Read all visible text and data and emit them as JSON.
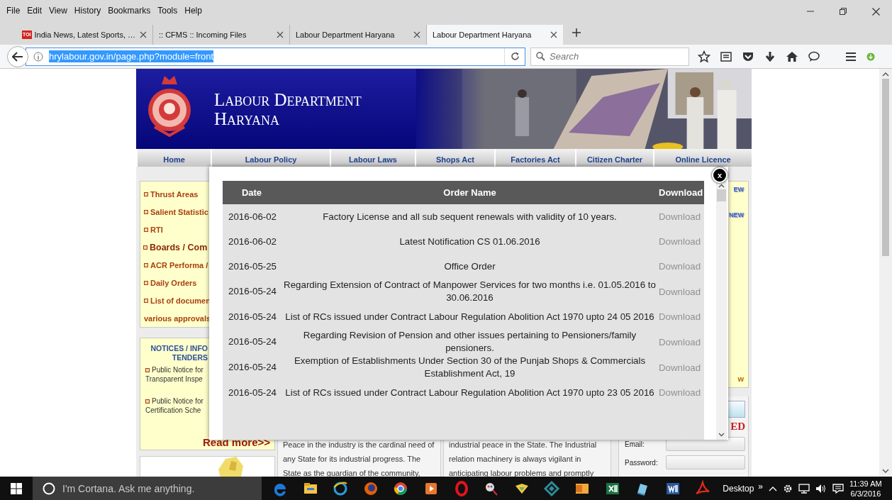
{
  "menu_bar": [
    "File",
    "Edit",
    "View",
    "History",
    "Bookmarks",
    "Tools",
    "Help"
  ],
  "tabs": [
    {
      "label": "India News, Latest Sports, …",
      "favicon_text": "TOI",
      "selected": false
    },
    {
      "label": ":: CFMS :: Incoming Files",
      "selected": false
    },
    {
      "label": "Labour Department Haryana",
      "selected": false
    },
    {
      "label": "Labour Department Haryana",
      "selected": true
    }
  ],
  "address_bar": {
    "value": "hrylabour.gov.in/page.php?module=front",
    "highlighted": true
  },
  "search": {
    "placeholder": "Search"
  },
  "site": {
    "title": [
      "Labour Department",
      "Haryana"
    ],
    "nav": [
      "Home",
      "Labour Policy",
      "Labour Laws",
      "Shops Act",
      "Factories Act",
      "Citizen Charter",
      "Online Licence"
    ],
    "sidebar_links": [
      {
        "label": "Thrust Areas",
        "kind": "link"
      },
      {
        "label": "Salient Statistic",
        "kind": "link"
      },
      {
        "label": "RTI",
        "kind": "link"
      },
      {
        "label": "Boards / Com",
        "kind": "heading"
      },
      {
        "label": "ACR Performa / ",
        "kind": "link"
      },
      {
        "label": "Daily Orders",
        "kind": "link"
      },
      {
        "label": "List of documen",
        "kind": "link"
      },
      {
        "label": "various approvals",
        "kind": "continuation"
      }
    ],
    "notices": {
      "title": [
        "NOTICES / INFO",
        "TENDERS"
      ],
      "items": [
        [
          "Public Notice for",
          "Transparent Inspe"
        ],
        [
          "Public Notice for",
          "Certification Sche"
        ]
      ]
    },
    "read_more": "Read more>>",
    "intro_columns": [
      [
        "Peace in the industry is the cardinal need of",
        "any State for its industrial progress. The",
        "State as the guardian of the community,"
      ],
      [
        "industrial peace in the State. The Industrial",
        "relation machinery is always vigilant in",
        "anticipating labour problems and promptly"
      ]
    ],
    "right_panel": {
      "badges": [
        "EW",
        "NEW"
      ],
      "fragment": "w",
      "login": {
        "heading": "ED",
        "fields": [
          {
            "label": "Email:"
          },
          {
            "label": "Password:"
          }
        ]
      }
    }
  },
  "modal": {
    "close": "x",
    "columns": [
      "Date",
      "Order Name",
      "Download"
    ],
    "rows": [
      {
        "date": "2016-06-02",
        "order": "Factory License and all sub sequent renewals with validity of 10 years.",
        "action": "Download"
      },
      {
        "date": "2016-06-02",
        "order": "Latest Notification CS 01.06.2016",
        "action": "Download"
      },
      {
        "date": "2016-05-25",
        "order": "Office Order",
        "action": "Download"
      },
      {
        "date": "2016-05-24",
        "order": "Regarding Extension of Contract of Manpower Services for two months i.e. 01.05.2016 to 30.06.2016",
        "action": "Download"
      },
      {
        "date": "2016-05-24",
        "order": "List of RCs issued under Contract Labour Regulation Abolition Act 1970 upto 24 05 2016",
        "action": "Download"
      },
      {
        "date": "2016-05-24",
        "order": "Regarding Revision of Pension and other issues pertaining to Pensioners/family pensioners.",
        "action": "Download"
      },
      {
        "date": "2016-05-24",
        "order": "Exemption of Establishments Under Section 30 of the Punjab Shops & Commercials Establishment Act, 19",
        "action": "Download"
      },
      {
        "date": "2016-05-24",
        "order": "List of RCs issued under Contract Labour Regulation Abolition Act 1970 upto 23 05 2016",
        "action": "Download"
      }
    ]
  },
  "taskbar": {
    "search_placeholder": "I'm Cortana. Ask me anything.",
    "desktop_label": "Desktop",
    "overflow": "»",
    "time": "11:39 AM",
    "date": "6/3/2016"
  }
}
